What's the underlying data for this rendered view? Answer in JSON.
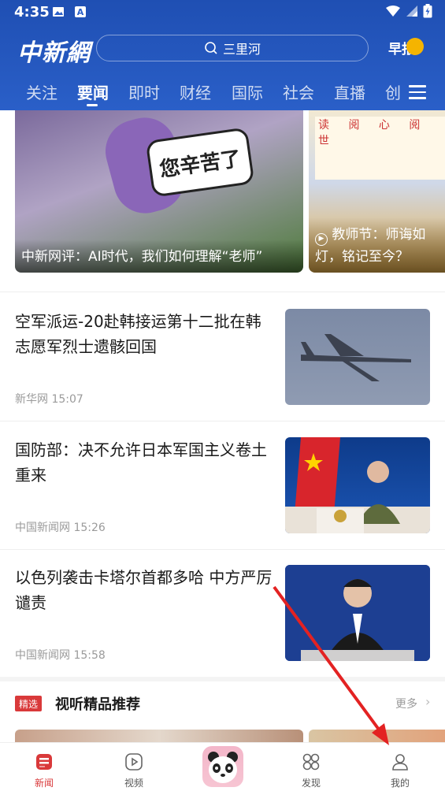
{
  "status_bar": {
    "time": "4:35"
  },
  "header": {
    "logo": "中新網",
    "search": {
      "placeholder": "三里河"
    },
    "morning_label": "早报"
  },
  "tabs": [
    {
      "label": "关注"
    },
    {
      "label": "要闻",
      "active": true
    },
    {
      "label": "即时"
    },
    {
      "label": "财经"
    },
    {
      "label": "国际"
    },
    {
      "label": "社会"
    },
    {
      "label": "直播"
    },
    {
      "label": "创"
    }
  ],
  "carousel": {
    "main_caption": "中新网评：AI时代，我们如何理解“老师”",
    "main_sign_text": "您辛苦了",
    "side_caption": "教师节：师诲如灯，铭记至今？",
    "side_board_text": "读 阅 心 阅 世"
  },
  "news": [
    {
      "title": "空军派运-20赴韩接运第十二批在韩志愿军烈士遗骸回国",
      "source": "新华网",
      "time": "15:07"
    },
    {
      "title": "国防部：决不允许日本军国主义卷土重来",
      "source": "中国新闻网",
      "time": "15:26"
    },
    {
      "title": "以色列袭击卡塔尔首都多哈 中方严厉谴责",
      "source": "中国新闻网",
      "time": "15:58"
    }
  ],
  "section": {
    "badge": "精选",
    "title": "视听精品推荐",
    "more": "更多"
  },
  "bottom_nav": [
    {
      "label": "新闻",
      "icon": "news-icon",
      "active": true
    },
    {
      "label": "视频",
      "icon": "video-play-icon"
    },
    {
      "label": "",
      "icon": "panda-icon"
    },
    {
      "label": "发现",
      "icon": "discover-grid-icon"
    },
    {
      "label": "我的",
      "icon": "profile-icon"
    }
  ],
  "colors": {
    "header_blue": "#2a5fc8",
    "accent_red": "#d9393a",
    "annotation_red": "#e32222"
  }
}
